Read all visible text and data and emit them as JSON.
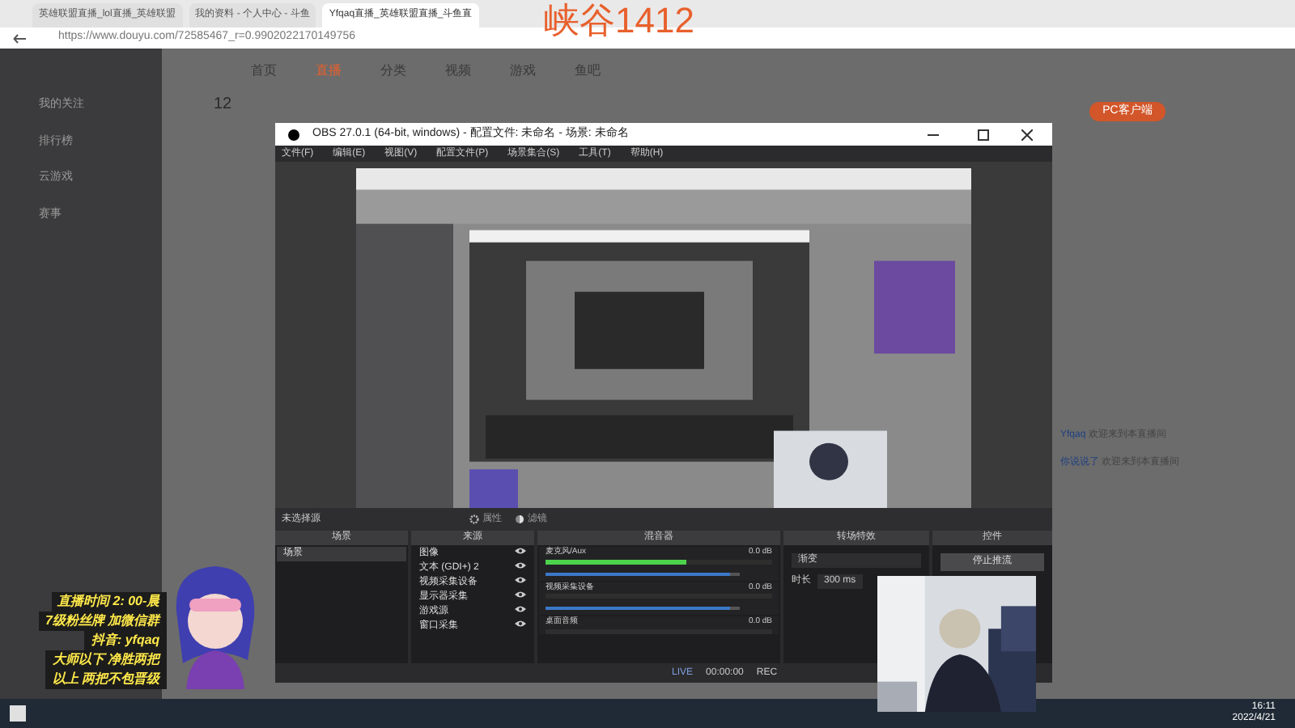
{
  "browser": {
    "tabs": [
      {
        "label": "英雄联盟直播_lol直播_英雄联盟",
        "selected": false
      },
      {
        "label": "我的资料 - 个人中心 - 斗鱼",
        "selected": false
      },
      {
        "label": "Yfqaq直播_英雄联盟直播_斗鱼直",
        "selected": true
      }
    ],
    "url": "https://www.douyu.com/72585467_r=0.9902022170149756"
  },
  "stream_caption": "峡谷1412",
  "site": {
    "nav": [
      {
        "label": "首页",
        "selected": false
      },
      {
        "label": "直播",
        "selected": true
      },
      {
        "label": "分类",
        "selected": false
      },
      {
        "label": "视频",
        "selected": false
      },
      {
        "label": "游戏",
        "selected": false
      },
      {
        "label": "鱼吧",
        "selected": false
      }
    ],
    "sidebar": [
      {
        "label": "我的关注"
      },
      {
        "label": "排行榜"
      },
      {
        "label": "云游戏"
      },
      {
        "label": "赛事"
      }
    ],
    "follow_count": "12",
    "client_button": "PC客户端",
    "chat": [
      {
        "user": "Yfqaq",
        "text": "欢迎来到本直播间"
      },
      {
        "user": "你说说了",
        "text": "欢迎来到本直播间"
      }
    ]
  },
  "obs": {
    "title": "OBS 27.0.1 (64-bit, windows) - 配置文件: 未命名 - 场景: 未命名",
    "menu": [
      "文件(F)",
      "编辑(E)",
      "视图(V)",
      "配置文件(P)",
      "场景集合(S)",
      "工具(T)",
      "帮助(H)"
    ],
    "no_source": "未选择源",
    "props_button": "属性",
    "filters_button": "滤镜",
    "docks": [
      "场景",
      "来源",
      "混音器",
      "转场特效",
      "控件"
    ],
    "scenes": [
      {
        "label": "场景",
        "selected": true
      }
    ],
    "sources": [
      {
        "label": "图像"
      },
      {
        "label": "文本 (GDI+) 2"
      },
      {
        "label": "视频采集设备"
      },
      {
        "label": "显示器采集"
      },
      {
        "label": "游戏源"
      },
      {
        "label": "窗口采集"
      }
    ],
    "mixer": [
      {
        "name": "麦克风/Aux",
        "reading": "0.0 dB",
        "level": 0.62,
        "volume": {
          "level": 0.95
        }
      },
      {
        "name": "视频采集设备",
        "reading": "0.0 dB",
        "volume": {
          "level": 0.95
        }
      },
      {
        "name": "桌面音频",
        "reading": "0.0 dB"
      }
    ],
    "transition": "渐变",
    "duration_label": "时长",
    "duration": "300 ms",
    "stream_button": "停止推流",
    "status": {
      "live": "LIVE",
      "time": "00:00:00",
      "rec": "REC"
    }
  },
  "overlay": [
    "直播时间 2: 00-晨",
    "7级粉丝牌 加微信群",
    "抖音: yfqaq",
    "大师以下 净胜两把",
    "以上 两把不包晋级"
  ],
  "taskbar": {
    "time": "16:11",
    "date": "2022/4/21"
  }
}
